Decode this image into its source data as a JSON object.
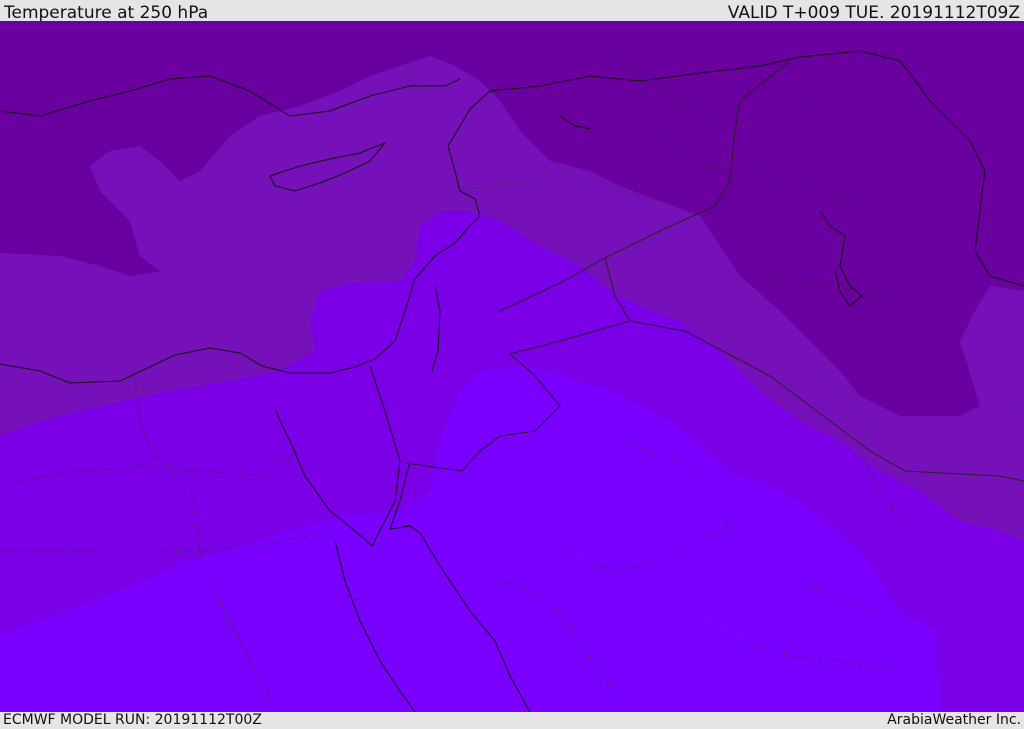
{
  "header": {
    "title": "Temperature at 250 hPa",
    "valid": "VALID T+009 TUE. 20191112T09Z"
  },
  "footer": {
    "model_run": "ECMWF MODEL RUN: 20191112T00Z",
    "credit": "ArabiaWeather Inc."
  },
  "map": {
    "colors": {
      "warmest_band": "#7a00ff",
      "band_2": "#7b00e8",
      "band_3": "#7611b9",
      "coldest_band": "#6a00a0",
      "coastline": "#111111",
      "border": "#222222"
    }
  }
}
